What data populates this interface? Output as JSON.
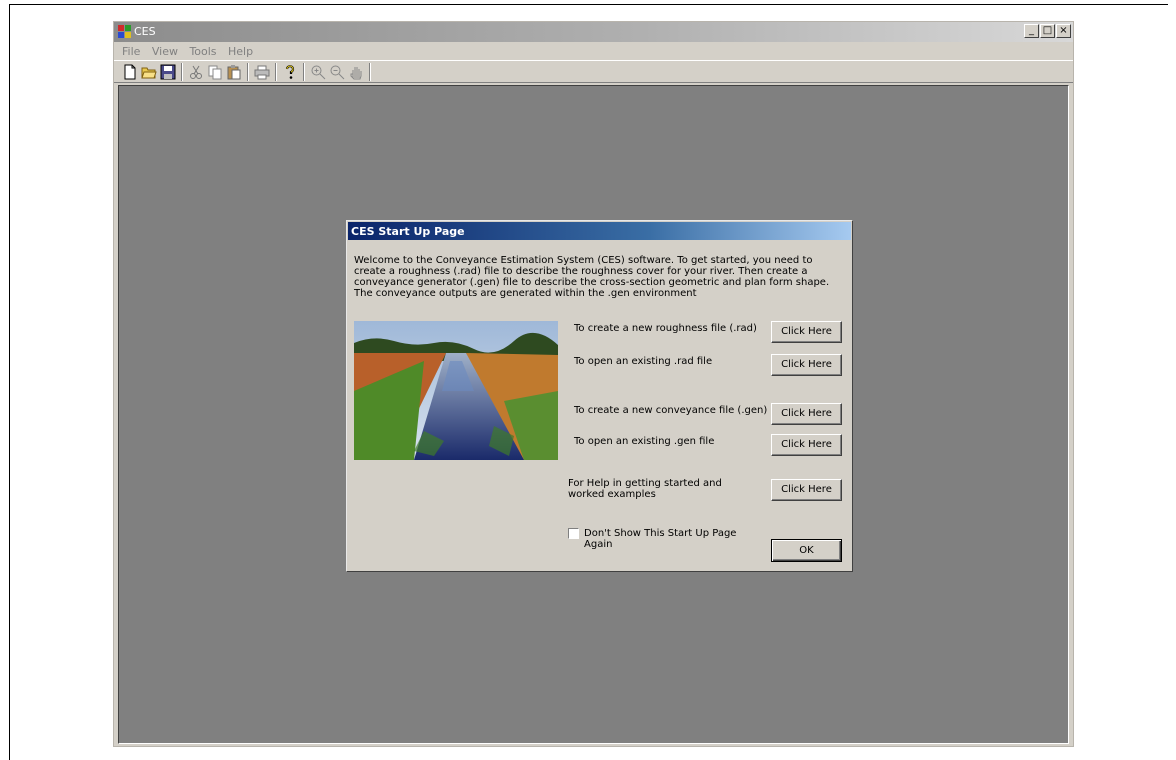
{
  "window": {
    "title": "CES",
    "controls": {
      "minimize": "_",
      "maximize": "□",
      "close": "×"
    }
  },
  "menu": {
    "items": [
      {
        "label": "File"
      },
      {
        "label": "View"
      },
      {
        "label": "Tools"
      },
      {
        "label": "Help"
      }
    ]
  },
  "toolbar": {
    "icons": [
      "new-file-icon",
      "open-folder-icon",
      "save-icon",
      "cut-icon",
      "copy-icon",
      "paste-icon",
      "print-icon",
      "help-icon",
      "zoom-in-icon",
      "zoom-out-icon",
      "pan-hand-icon"
    ]
  },
  "dialog": {
    "title": "CES Start Up Page",
    "intro": "Welcome to the Conveyance Estimation System (CES) software.  To get started, you need to create a roughness (.rad) file to describe the roughness cover for your river.  Then create a conveyance generator (.gen) file to describe the cross-section geometric and plan form shape.  The conveyance outputs are generated within the .gen environment",
    "rows": [
      {
        "label": "To create a new roughness file (.rad)",
        "button": "Click Here"
      },
      {
        "label": "To open an existing .rad file",
        "button": "Click Here"
      },
      {
        "label": "To create a new conveyance file (.gen)",
        "button": "Click Here"
      },
      {
        "label": "To open an existing .gen file",
        "button": "Click Here"
      },
      {
        "label": "For Help in getting started and worked examples",
        "button": "Click Here"
      }
    ],
    "checkbox_label": "Don't Show This Start Up Page Again",
    "checkbox_checked": false,
    "ok_label": "OK"
  }
}
